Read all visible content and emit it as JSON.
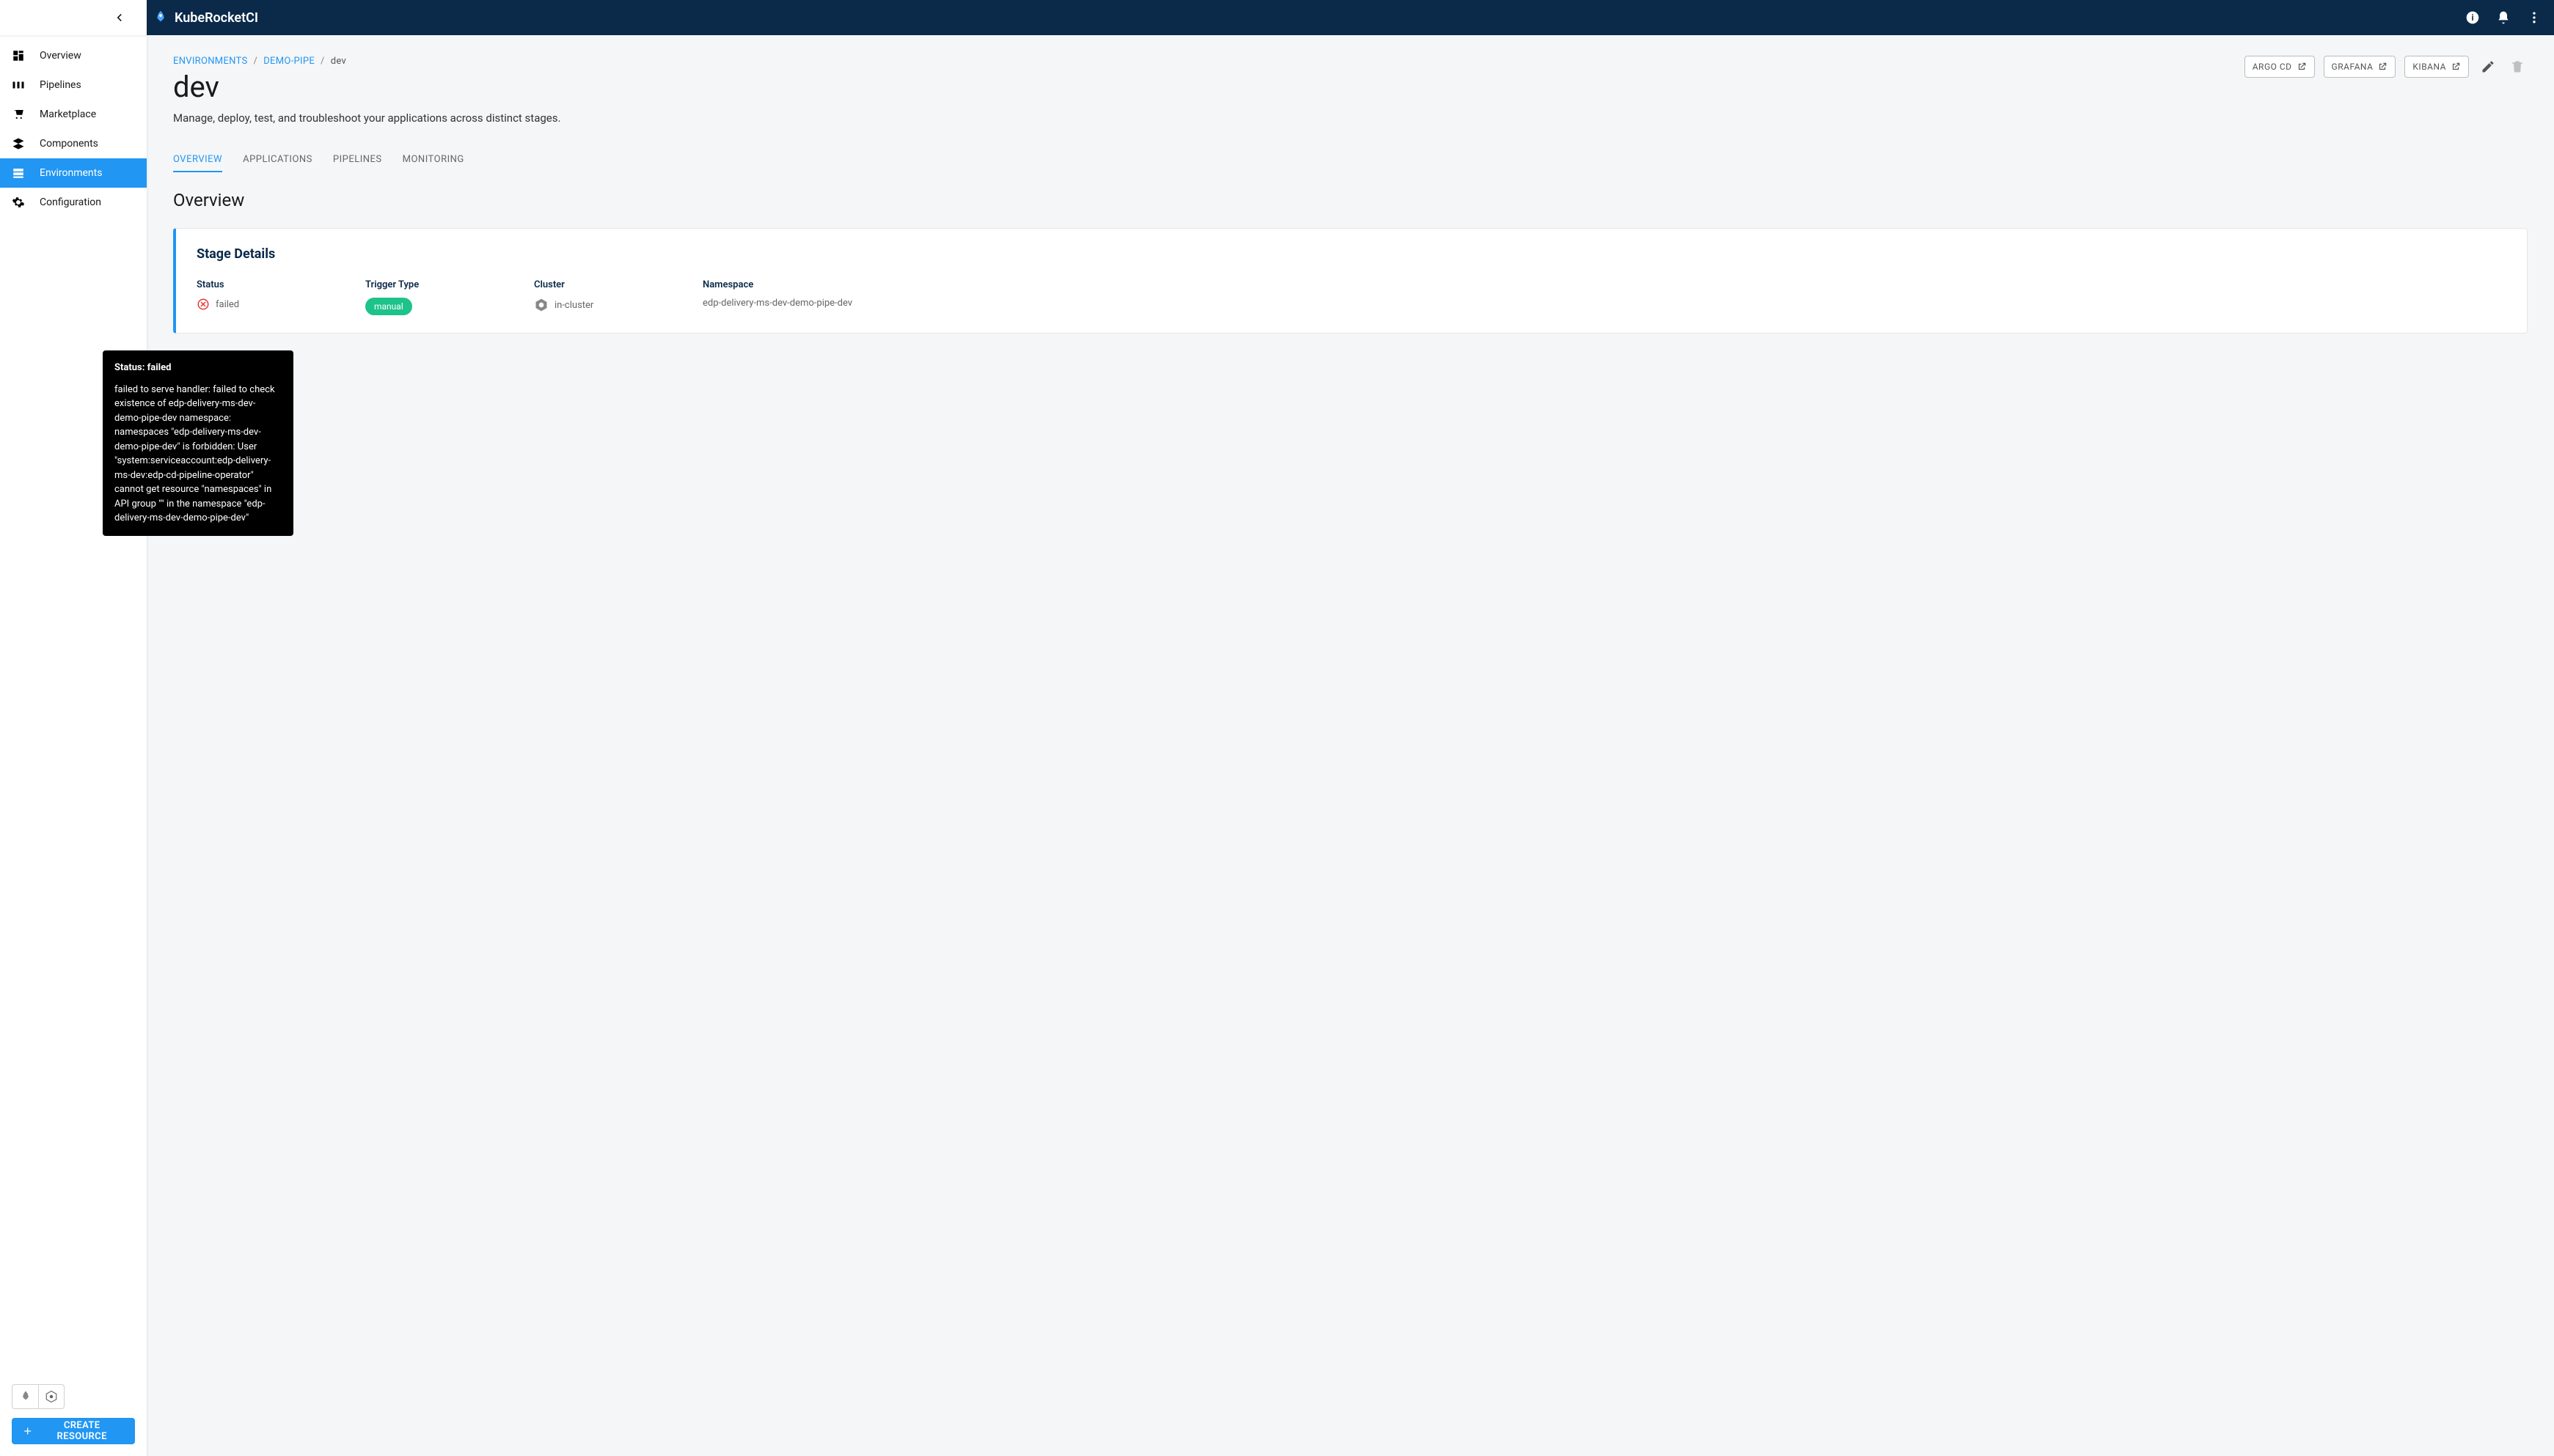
{
  "brand": {
    "name": "KubeRocketCI"
  },
  "nav": {
    "items": [
      {
        "label": "Overview"
      },
      {
        "label": "Pipelines"
      },
      {
        "label": "Marketplace"
      },
      {
        "label": "Components"
      },
      {
        "label": "Environments"
      },
      {
        "label": "Configuration"
      }
    ],
    "active_index": 4,
    "create_button": "CREATE RESOURCE"
  },
  "breadcrumbs": {
    "items": [
      {
        "label": "ENVIRONMENTS"
      },
      {
        "label": "DEMO-PIPE"
      }
    ],
    "current": "dev"
  },
  "page": {
    "title": "dev",
    "subtitle": "Manage, deploy, test, and troubleshoot your applications across distinct stages."
  },
  "header_links": [
    {
      "label": "ARGO CD"
    },
    {
      "label": "GRAFANA"
    },
    {
      "label": "KIBANA"
    }
  ],
  "tabs": {
    "items": [
      {
        "label": "OVERVIEW"
      },
      {
        "label": "APPLICATIONS"
      },
      {
        "label": "PIPELINES"
      },
      {
        "label": "MONITORING"
      }
    ],
    "active_index": 0
  },
  "overview": {
    "heading": "Overview",
    "card_title": "Stage Details",
    "details": {
      "status": {
        "label": "Status",
        "value": "failed"
      },
      "trigger_type": {
        "label": "Trigger Type",
        "value": "manual"
      },
      "cluster": {
        "label": "Cluster",
        "value": "in-cluster"
      },
      "namespace": {
        "label": "Namespace",
        "value": "edp-delivery-ms-dev-demo-pipe-dev"
      }
    }
  },
  "tooltip": {
    "title": "Status: failed",
    "body": "failed to serve handler: failed to check existence of edp-delivery-ms-dev-demo-pipe-dev namespace: namespaces \"edp-delivery-ms-dev-demo-pipe-dev\" is forbidden: User \"system:serviceaccount:edp-delivery-ms-dev:edp-cd-pipeline-operator\" cannot get resource \"namespaces\" in API group \"\" in the namespace \"edp-delivery-ms-dev-demo-pipe-dev\""
  }
}
